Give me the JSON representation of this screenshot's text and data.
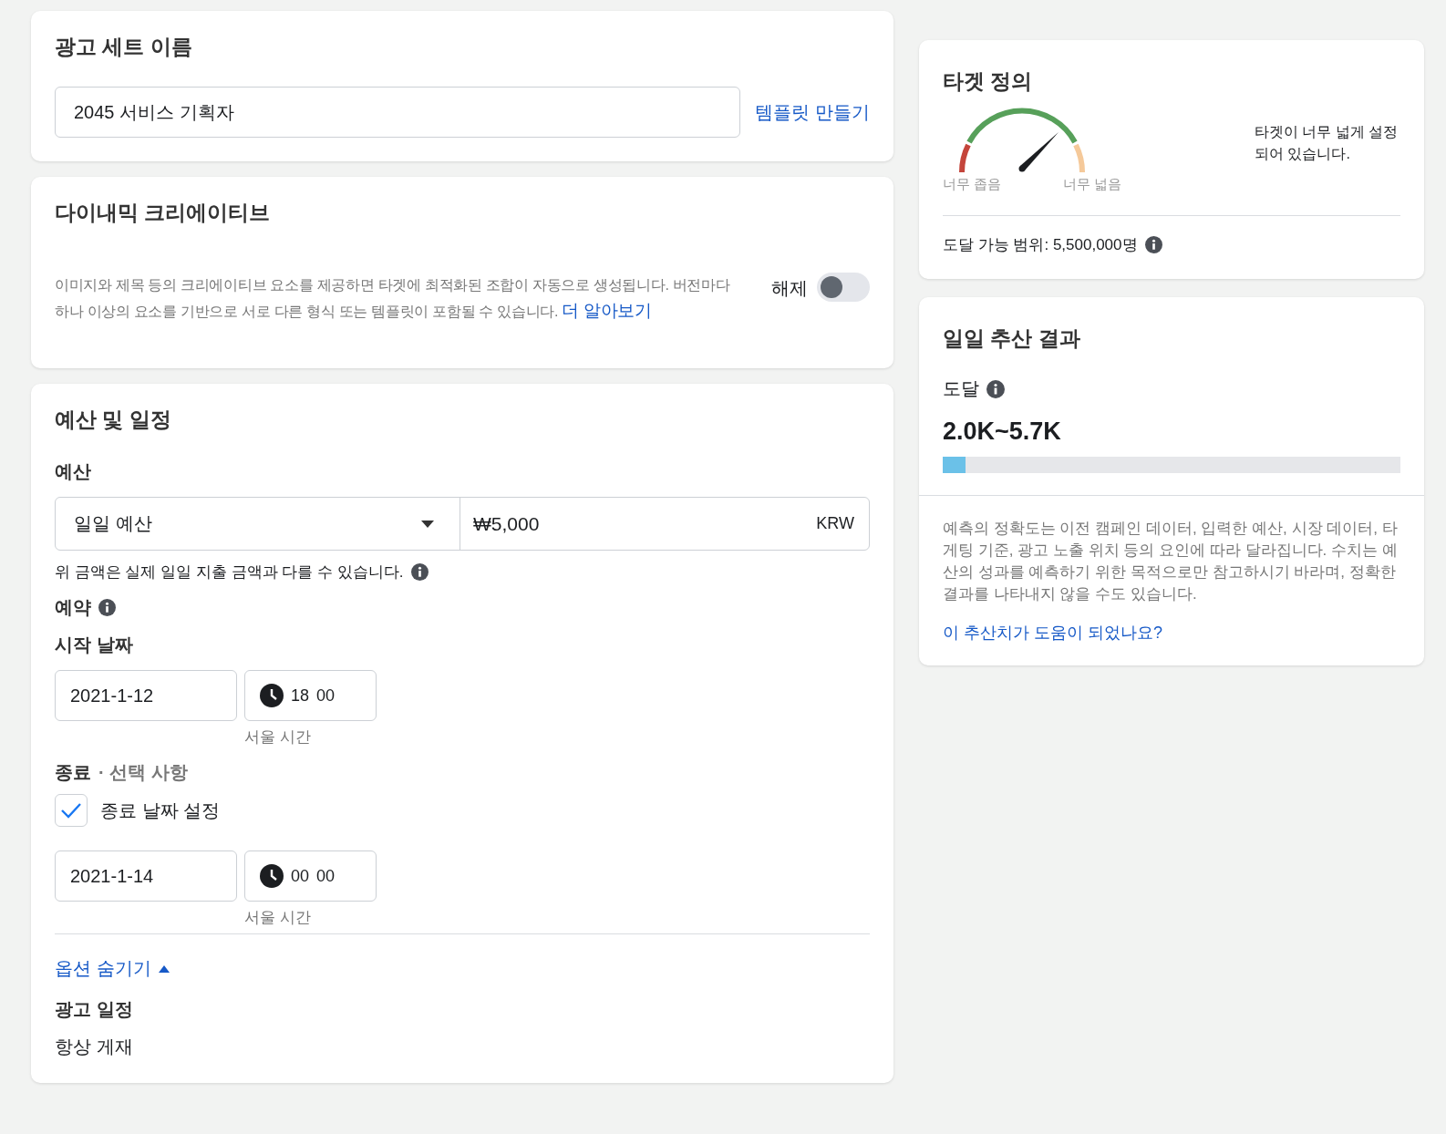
{
  "ad_set_name": {
    "title": "광고 세트 이름",
    "value": "2045 서비스 기획자",
    "template_link": "템플릿 만들기"
  },
  "dynamic_creative": {
    "title": "다이내믹 크리에이티브",
    "description": "이미지와 제목 등의 크리에이티브 요소를 제공하면 타겟에 최적화된 조합이 자동으로 생성됩니다. 버전마다 하나 이상의 요소를 기반으로 서로 다른 형식 또는 템플릿이 포함될 수 있습니다.",
    "learn_more": "더 알아보기",
    "toggle_label": "해제",
    "on": false
  },
  "budget_schedule": {
    "title": "예산 및 일정",
    "budget_label": "예산",
    "budget_type": "일일 예산",
    "amount": "₩5,000",
    "currency": "KRW",
    "note": "위 금액은 실제 일일 지출 금액과 다를 수 있습니다.",
    "schedule_label": "예약",
    "start_label": "시작 날짜",
    "start_date": "2021-1-12",
    "start_hour": "18",
    "start_minute": "00",
    "start_tz": "서울 시간",
    "end_label": "종료",
    "end_optional": "· 선택 사항",
    "end_checkbox": {
      "label": "종료 날짜 설정",
      "checked": true
    },
    "end_date": "2021-1-14",
    "end_hour": "00",
    "end_minute": "00",
    "end_tz": "서울 시간",
    "hide_options": "옵션 숨기기",
    "ad_schedule_label": "광고 일정",
    "ad_schedule_value": "항상 게재"
  },
  "audience": {
    "title": "타겟 정의",
    "narrow": "너무 좁음",
    "broad": "너무 넓음",
    "message": "타겟이 너무 넓게 설정되어 있습니다.",
    "reach": "도달 가능 범위: 5,500,000명"
  },
  "estimate": {
    "title": "일일 추산 결과",
    "reach_label": "도달",
    "reach_value": "2.0K~5.7K",
    "level": 0.05,
    "disclaimer": "예측의 정확도는 이전 캠페인 데이터, 입력한 예산, 시장 데이터, 타게팅 기준, 광고 노출 위치 등의 요인에 따라 달라집니다. 수치는 예산의 성과를 예측하기 위한 목적으로만 참고하시기 바라며, 정확한 결과를 나타내지 않을 수도 있습니다.",
    "feedback_link": "이 추산치가 도움이 되었나요?"
  }
}
